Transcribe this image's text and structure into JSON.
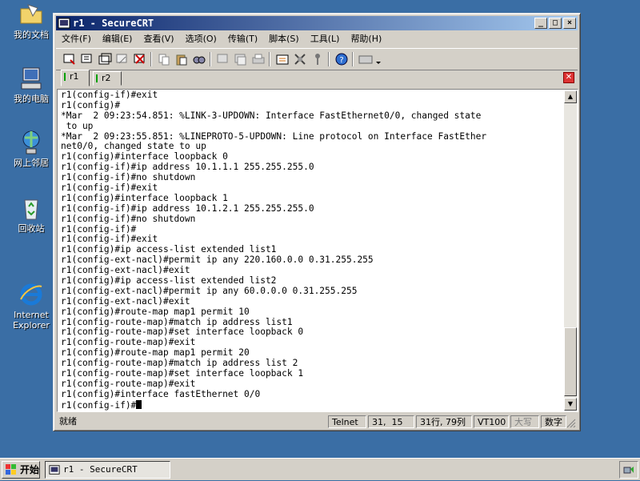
{
  "desktop": {
    "icons": [
      {
        "label": "我的文档"
      },
      {
        "label": "我的电脑"
      },
      {
        "label": "网上邻居"
      },
      {
        "label": "回收站"
      },
      {
        "label": "Internet\nExplorer"
      }
    ]
  },
  "window": {
    "title": "r1 - SecureCRT",
    "controls": {
      "minimize": "_",
      "maximize": "□",
      "close": "×"
    }
  },
  "menu": [
    {
      "label": "文件(F)"
    },
    {
      "label": "编辑(E)"
    },
    {
      "label": "查看(V)"
    },
    {
      "label": "选项(O)"
    },
    {
      "label": "传输(T)"
    },
    {
      "label": "脚本(S)"
    },
    {
      "label": "工具(L)"
    },
    {
      "label": "帮助(H)"
    }
  ],
  "tabs": [
    {
      "label": "r1",
      "active": true
    },
    {
      "label": "r2",
      "active": false
    }
  ],
  "terminal": {
    "lines": [
      "r1(config-if)#exit",
      "r1(config)#",
      "*Mar  2 09:23:54.851: %LINK-3-UPDOWN: Interface FastEthernet0/0, changed state",
      " to up",
      "*Mar  2 09:23:55.851: %LINEPROTO-5-UPDOWN: Line protocol on Interface FastEther",
      "net0/0, changed state to up",
      "r1(config)#interface loopback 0",
      "r1(config-if)#ip address 10.1.1.1 255.255.255.0",
      "r1(config-if)#no shutdown",
      "r1(config-if)#exit",
      "r1(config)#interface loopback 1",
      "r1(config-if)#ip address 10.1.2.1 255.255.255.0",
      "r1(config-if)#no shutdown",
      "r1(config-if)#",
      "r1(config-if)#exit",
      "r1(config)#ip access-list extended list1",
      "r1(config-ext-nacl)#permit ip any 220.160.0.0 0.31.255.255",
      "r1(config-ext-nacl)#exit",
      "r1(config)#ip access-list extended list2",
      "r1(config-ext-nacl)#permit ip any 60.0.0.0 0.31.255.255",
      "r1(config-ext-nacl)#exit",
      "r1(config)#route-map map1 permit 10",
      "r1(config-route-map)#match ip address list1",
      "r1(config-route-map)#set interface loopback 0",
      "r1(config-route-map)#exit",
      "r1(config)#route-map map1 permit 20",
      "r1(config-route-map)#match ip address list 2",
      "r1(config-route-map)#set interface loopback 1",
      "r1(config-route-map)#exit",
      "r1(config)#interface fastEthernet 0/0"
    ],
    "prompt": "r1(config-if)#"
  },
  "status": {
    "ready": "就绪",
    "protocol": "Telnet",
    "cursor_pos": "31,  15",
    "line_col": "31行, 79列",
    "emulation": "VT100",
    "caps": "大写",
    "num": "数字"
  },
  "taskbar": {
    "start_label": "开始",
    "task_label": "r1 - SecureCRT"
  }
}
